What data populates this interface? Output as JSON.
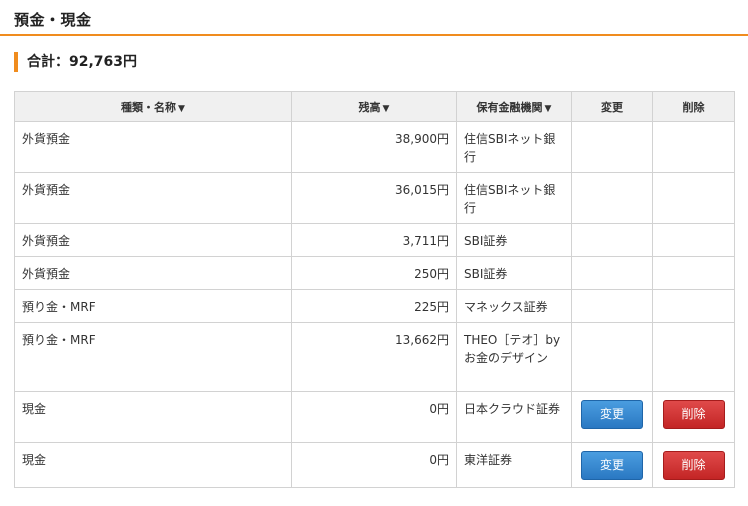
{
  "page": {
    "title": "預金・現金",
    "total_label": "合計：92,763円"
  },
  "table": {
    "headers": [
      {
        "label": "種類・名称",
        "sort": "▼"
      },
      {
        "label": "残高",
        "sort": "▼"
      },
      {
        "label": "保有金融機関",
        "sort": "▼"
      },
      {
        "label": "変更",
        "sort": ""
      },
      {
        "label": "削除",
        "sort": ""
      }
    ],
    "rows": [
      {
        "type": "外貨預金",
        "balance": "38,900円",
        "institution": "住信SBIネット銀行"
      },
      {
        "type": "外貨預金",
        "balance": "36,015円",
        "institution": "住信SBIネット銀行"
      },
      {
        "type": "外貨預金",
        "balance": "3,711円",
        "institution": "SBI証券"
      },
      {
        "type": "外貨預金",
        "balance": "250円",
        "institution": "SBI証券"
      },
      {
        "type": "預り金・MRF",
        "balance": "225円",
        "institution": "マネックス証券"
      },
      {
        "type": "預り金・MRF",
        "balance": "13,662円",
        "institution": "THEO［テオ］by お金のデザイン"
      },
      {
        "type": "現金",
        "balance": "0円",
        "institution": "日本クラウド証券",
        "edit_label": "変更",
        "delete_label": "削除"
      },
      {
        "type": "現金",
        "balance": "0円",
        "institution": "東洋証券",
        "edit_label": "変更",
        "delete_label": "削除"
      }
    ]
  },
  "colors": {
    "accent": "#f08c1e",
    "edit_button": "#3385d1",
    "delete_button": "#d33030"
  }
}
